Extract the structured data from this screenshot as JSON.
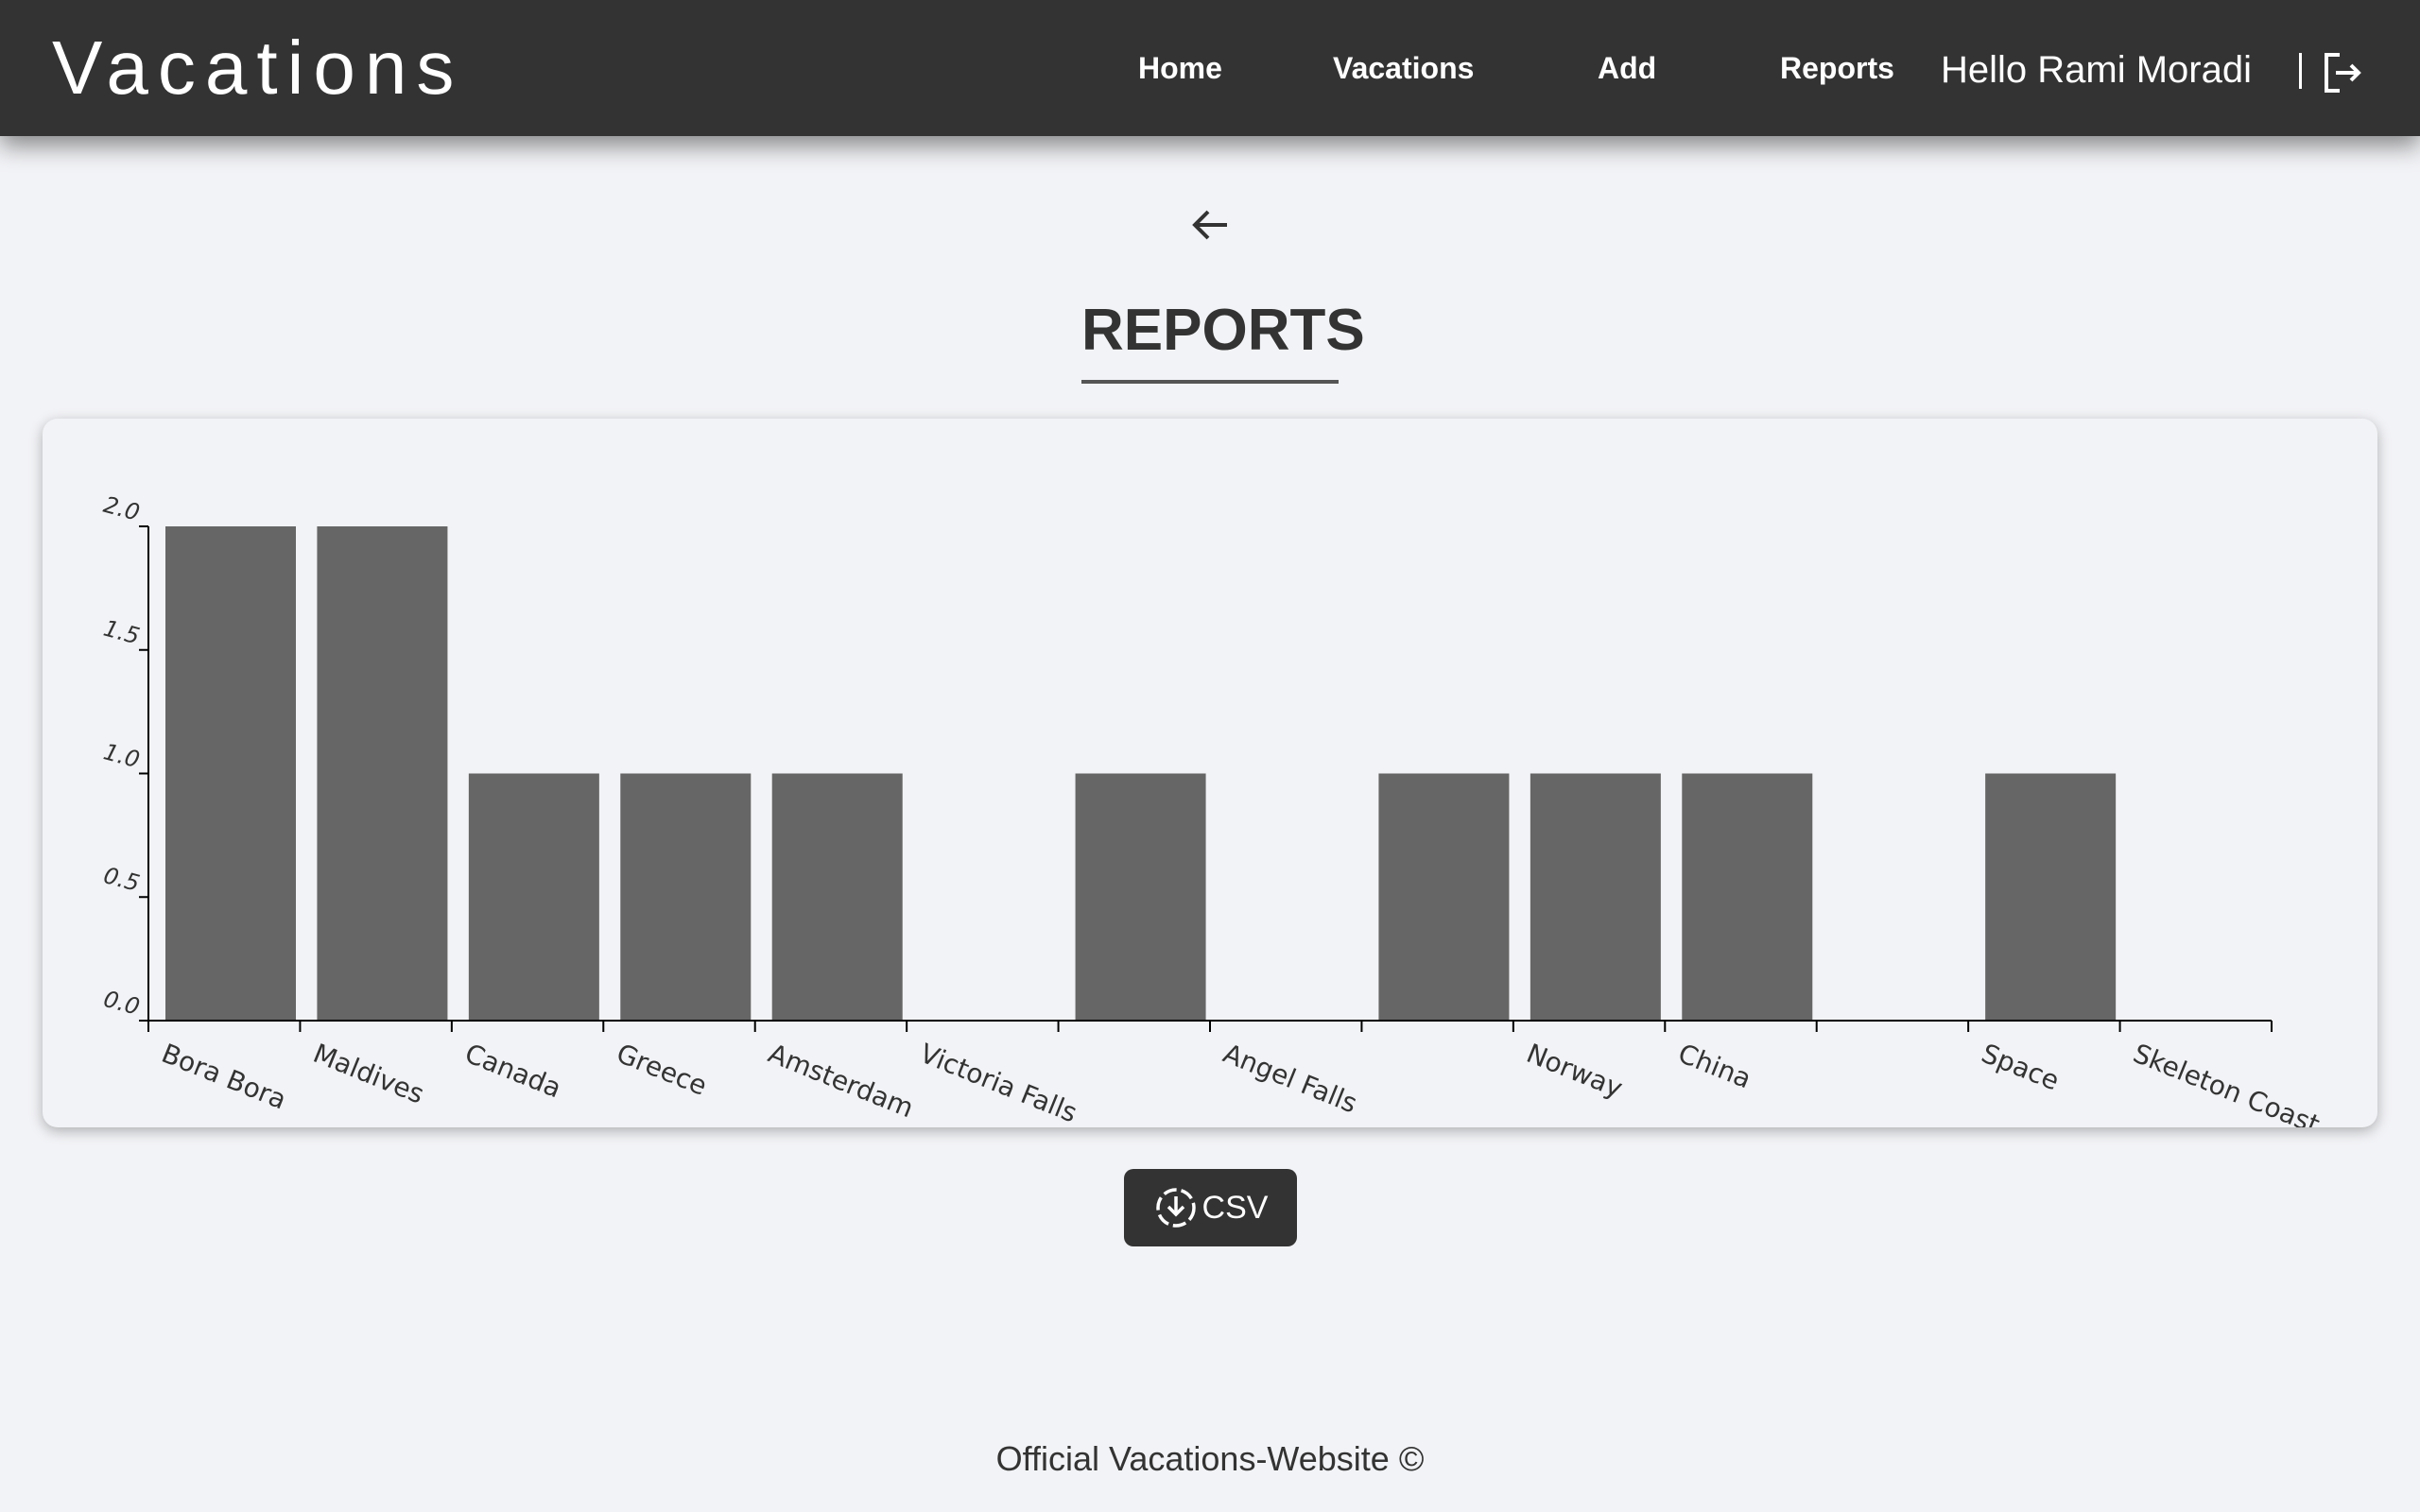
{
  "header": {
    "brand": "Vacations",
    "nav": {
      "home": "Home",
      "vacations": "Vacations",
      "add": "Add",
      "reports": "Reports"
    },
    "greeting": "Hello Rami Moradi",
    "icons": {
      "logout": "logout-icon"
    },
    "background_color": "#333333"
  },
  "main": {
    "back_icon": "arrow-left-icon",
    "title": "REPORTS",
    "csv_button": {
      "label": "CSV",
      "icon": "download-icon"
    }
  },
  "chart_data": {
    "type": "bar",
    "categories": [
      "Bora Bora",
      "Maldives",
      "Canada",
      "Greece",
      "Amsterdam",
      "Victoria Falls",
      "",
      "Angel Falls",
      "",
      "Norway",
      "China",
      "",
      "Space",
      "Skeleton Coast"
    ],
    "values": [
      2,
      2,
      1,
      1,
      1,
      0,
      1,
      0,
      1,
      1,
      1,
      0,
      1
    ],
    "tick_labels": [
      "0.0",
      "0.5",
      "1.0",
      "1.5",
      "2.0"
    ],
    "ylim": [
      0,
      2
    ],
    "title": "",
    "xlabel": "",
    "ylabel": "",
    "bar_color": "#666666",
    "grid": false
  },
  "footer": {
    "text": "Official Vacations-Website ©"
  }
}
